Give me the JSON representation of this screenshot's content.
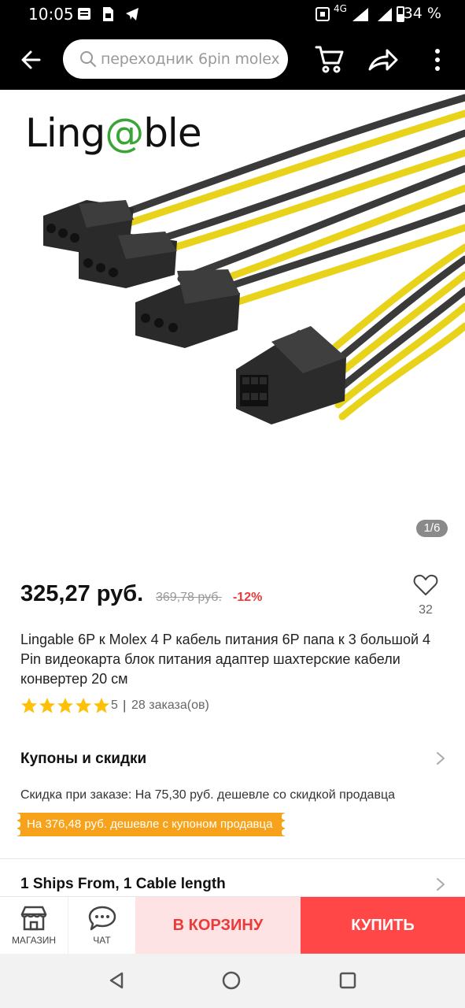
{
  "status_bar": {
    "time": "10:05",
    "network": "4G",
    "battery": "34 %"
  },
  "header": {
    "search_placeholder": "переходник 6pin molex",
    "icons": [
      "back-arrow-icon",
      "search-icon",
      "cart-icon",
      "share-icon",
      "more-vertical-icon"
    ]
  },
  "gallery": {
    "brand_logo_text": "Lingable",
    "counter": "1/6"
  },
  "product": {
    "price": "325,27 руб.",
    "old_price": "369,78 руб.",
    "discount": "-12%",
    "wishlist_count": "32",
    "title": "Lingable 6P к Molex 4 P кабель питания 6P папа к 3 большой 4 Pin видеокарта блок питания адаптер шахтерские кабели конвертер 20 см",
    "rating": {
      "stars": 5,
      "value": "5",
      "separator": "|",
      "orders": "28 заказа(ов)"
    }
  },
  "coupons": {
    "title": "Купоны и скидки",
    "seller_discount": "Скидка при заказе: На 75,30 руб. дешевле со скидкой продавца",
    "coupon_tag": "На 376,48 руб. дешевле с купоном продавца"
  },
  "shipping": {
    "title": "1 Ships From, 1 Cable length"
  },
  "action_bar": {
    "store_label": "МАГАЗИН",
    "chat_label": "ЧАТ",
    "add_to_cart": "В КОРЗИНУ",
    "buy": "КУПИТЬ"
  },
  "colors": {
    "accent_red": "#ff4747",
    "cart_bg": "#fde3e3",
    "coupon_orange": "#f7a21b",
    "discount_red": "#ea3a3a",
    "logo_green": "#3aa537"
  }
}
